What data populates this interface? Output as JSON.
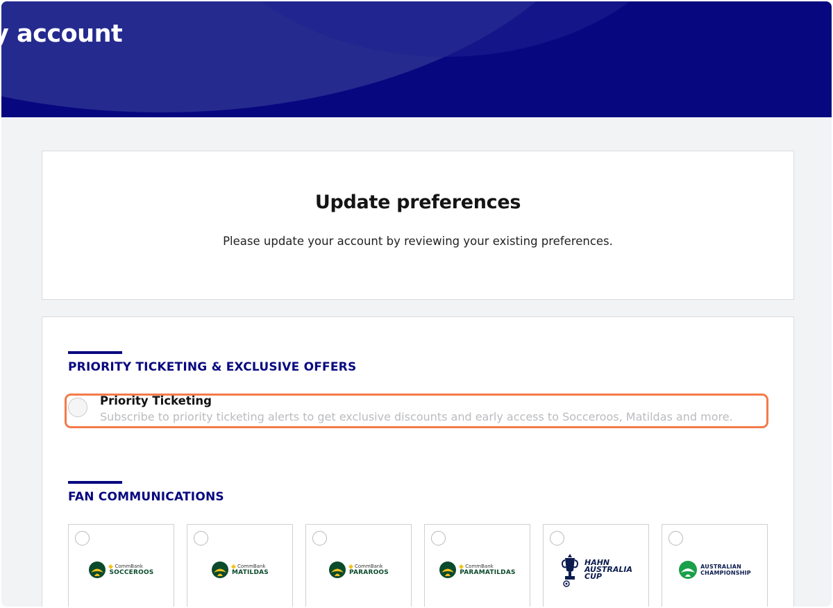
{
  "header": {
    "title": "y account"
  },
  "intro": {
    "title": "Update preferences",
    "description": "Please update your account by reviewing your existing preferences."
  },
  "sections": {
    "priority": {
      "title": "PRIORITY TICKETING & EXCLUSIVE OFFERS",
      "option": {
        "label": "Priority Ticketing",
        "description": "Subscribe to priority ticketing alerts to get exclusive discounts and early access to Socceroos, Matildas and more."
      }
    },
    "fan": {
      "title": "FAN COMMUNICATIONS",
      "tiles": [
        {
          "sponsor": "CommBank",
          "name": "SOCCEROOS"
        },
        {
          "sponsor": "CommBank",
          "name": "MATILDAS"
        },
        {
          "sponsor": "CommBank",
          "name": "PARAROOS"
        },
        {
          "sponsor": "CommBank",
          "name": "PARAMATILDAS"
        },
        {
          "line1": "HAHN",
          "line2": "AUSTRALIA",
          "line3": "CUP"
        },
        {
          "line1": "AUSTRALIAN",
          "line2": "CHAMPIONSHIP"
        }
      ]
    }
  },
  "colors": {
    "brand_navy": "#07077f",
    "highlight": "#f47a49",
    "logo_green": "#0b4a2c",
    "logo_gold": "#f4c21b"
  }
}
